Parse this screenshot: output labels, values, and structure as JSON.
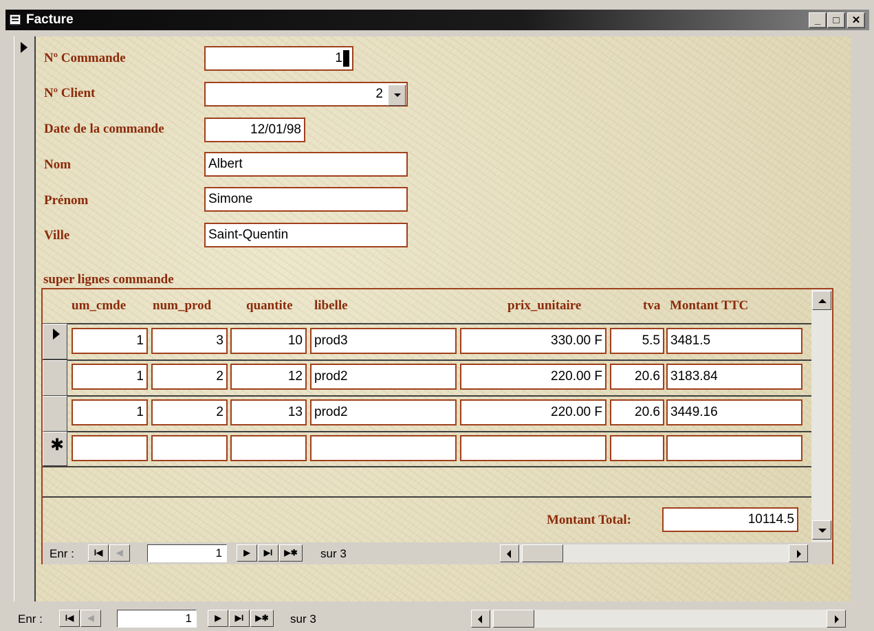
{
  "window": {
    "title": "Facture",
    "min_label": "_",
    "max_label": "□",
    "close_label": "✕"
  },
  "form": {
    "commande": {
      "label": "Nº Commande",
      "value": "1"
    },
    "client": {
      "label": "Nº Client",
      "value": "2"
    },
    "date": {
      "label": "Date de la commande",
      "value": "12/01/98"
    },
    "nom": {
      "label": "Nom",
      "value": "Albert"
    },
    "prenom": {
      "label": "Prénom",
      "value": "Simone"
    },
    "ville": {
      "label": "Ville",
      "value": "Saint-Quentin"
    }
  },
  "subform": {
    "title": "super lignes  commande",
    "columns": [
      "um_cmde",
      "num_prod",
      "quantite",
      "libelle",
      "prix_unitaire",
      "tva",
      "Montant TTC"
    ],
    "rows": [
      {
        "num_cmde": "1",
        "num_prod": "3",
        "quantite": "10",
        "libelle": "prod3",
        "prix_unitaire": "330.00 F",
        "tva": "5.5",
        "montant": "3481.5"
      },
      {
        "num_cmde": "1",
        "num_prod": "2",
        "quantite": "12",
        "libelle": "prod2",
        "prix_unitaire": "220.00 F",
        "tva": "20.6",
        "montant": "3183.84"
      },
      {
        "num_cmde": "1",
        "num_prod": "2",
        "quantite": "13",
        "libelle": "prod2",
        "prix_unitaire": "220.00 F",
        "tva": "20.6",
        "montant": "3449.16"
      }
    ],
    "new_row_marker": "✱",
    "total_label": "Montant Total:",
    "total_value": "10114.5",
    "nav": {
      "label": "Enr :",
      "current": "1",
      "of_text": "sur 3"
    }
  },
  "main_nav": {
    "label": "Enr :",
    "current": "1",
    "of_text": "sur 3"
  },
  "nav_glyphs": {
    "first": "I◀",
    "prev": "◀",
    "next": "▶",
    "last": "▶I",
    "new": "▶✱"
  }
}
